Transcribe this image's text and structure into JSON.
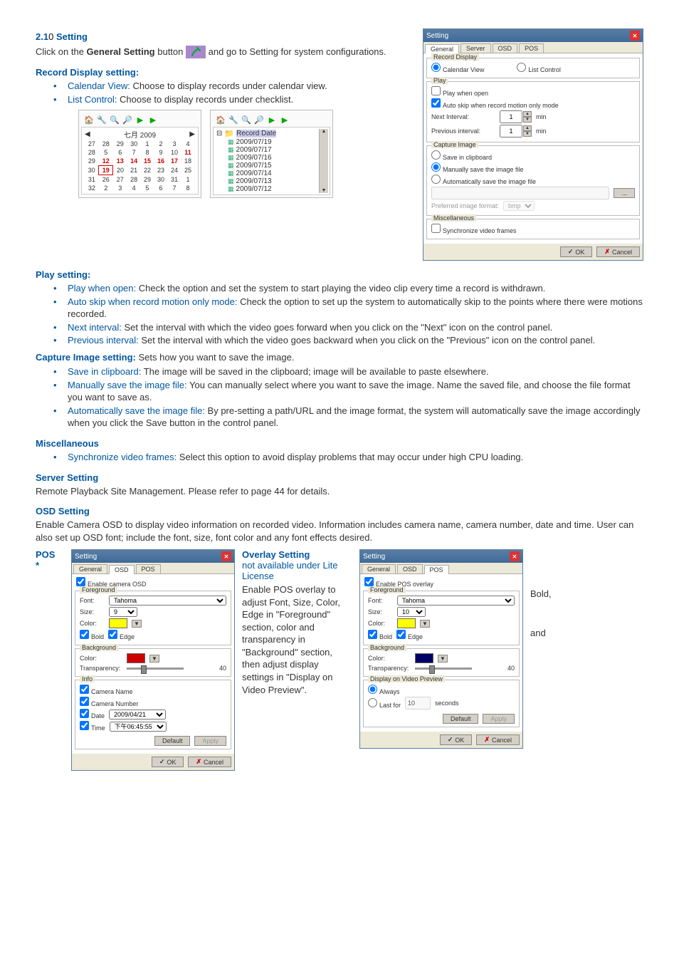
{
  "sections": {
    "title_num": "2.1",
    "title_num_suffix": "0",
    "title_text": "Setting",
    "intro1a": "Click on the ",
    "intro1b": "General Setting",
    "intro1c": " button ",
    "intro1d": " and go to Setting for system configurations.",
    "record_display_heading": "Record Display setting:",
    "record_display": [
      {
        "label": "Calendar View:",
        "text": " Choose to display records under calendar view."
      },
      {
        "label": "List Control:",
        "text": " Choose to display records under checklist."
      }
    ],
    "calendar_month": "七月 2009",
    "list_root": "Record Date",
    "list_items": [
      "2009/07/19",
      "2009/07/17",
      "2009/07/16",
      "2009/07/15",
      "2009/07/14",
      "2009/07/13",
      "2009/07/12"
    ],
    "play_heading": "Play setting:",
    "play": [
      {
        "label": "Play when open:",
        "text": " Check the option and set the system to start playing the video clip every time a record is withdrawn."
      },
      {
        "label": "Auto skip when record motion only mode:",
        "text": " Check the option to set up the system to automatically skip to the points where there were motions recorded."
      },
      {
        "label": "Next interval:",
        "text": " Set the interval with which the video goes forward when you click on the \"Next\" icon on the control panel."
      },
      {
        "label": "Previous interval:",
        "text": " Set the interval with which the video goes backward when you click on the \"Previous\" icon on the control panel."
      }
    ],
    "capture_heading_a": "Capture Image setting:",
    "capture_heading_b": " Sets how you want to save the image.",
    "capture": [
      {
        "label": "Save in clipboard:",
        "text": " The image will be saved in the clipboard; image will be available to paste elsewhere."
      },
      {
        "label": "Manually save the image file:",
        "text": " You can manually select where you want to save the image. Name the saved file, and choose the file format you want to save as."
      },
      {
        "label": "Automatically save the image file:",
        "text": " By pre-setting a path/URL and the image format, the system will automatically save the image accordingly when you click the Save button in the control panel."
      }
    ],
    "misc_heading": "Miscellaneous",
    "misc": [
      {
        "label": "Synchronize video frames:",
        "text": " Select this option to avoid display problems that may occur under high CPU loading."
      }
    ],
    "server_heading": "Server Setting",
    "server_text": "Remote Playback Site Management.    Please refer to page 44 for details.",
    "osd_heading": "OSD Setting",
    "osd_text": "Enable Camera OSD to display video information on recorded video.    Information includes camera name, camera number, date and time. User can also set up OSD font; include the font, size, font color and any font effects desired.",
    "pos_label": "POS",
    "pos_star": "*",
    "overlay_heading": "Overlay Setting",
    "overlay_sub": "not available under Lite License",
    "overlay_text": "Enable POS overlay to adjust Font, Size, Color, Edge in \"Foreground\" section, color and transparency in \"Background\" section, then adjust display settings in \"Display on Video Preview\".",
    "overlay_right1": "Bold,",
    "overlay_right2": "and"
  },
  "dialog1": {
    "title": "Setting",
    "tabs": [
      "General",
      "Server",
      "OSD",
      "POS"
    ],
    "groups": {
      "record_display": {
        "title": "Record Display",
        "calendar": "Calendar View",
        "list": "List Control"
      },
      "play": {
        "title": "Play",
        "open": "Play when open",
        "autoskip": "Auto skip when record motion only mode",
        "next": "Next Interval:",
        "prev": "Previous interval:",
        "min": "min",
        "val1": "1",
        "val2": "1"
      },
      "capture": {
        "title": "Capture Image",
        "clip": "Save in clipboard",
        "manual": "Manually save the image file",
        "auto": "Automatically save the image file",
        "pref": "Preferred image format:",
        "fmt": "bmp",
        "browse": "..."
      },
      "misc": {
        "title": "Miscellaneous",
        "sync": "Synchronize video frames"
      }
    },
    "ok": "OK",
    "cancel": "Cancel"
  },
  "dialog2": {
    "title": "Setting",
    "tabs": [
      "General",
      "OSD",
      "POS"
    ],
    "enable": "Enable camera OSD",
    "fore": {
      "title": "Foreground",
      "font_l": "Font:",
      "font_v": "Tahoma",
      "size_l": "Size:",
      "size_v": "9",
      "color_l": "Color:",
      "bold": "Bold",
      "edge": "Edge"
    },
    "back": {
      "title": "Background",
      "color_l": "Color:",
      "trans_l": "Transparency:",
      "trans_v": "40"
    },
    "info": {
      "title": "Info",
      "cam_name": "Camera Name",
      "cam_num": "Camera Number",
      "date_l": "Date",
      "date_v": "2009/04/21",
      "time_l": "Time",
      "time_v": "下午06:45:55"
    },
    "default": "Default",
    "apply": "Apply",
    "ok": "OK",
    "cancel": "Cancel"
  },
  "dialog3": {
    "title": "Setting",
    "tabs": [
      "General",
      "OSD",
      "POS"
    ],
    "enable": "Enable POS overlay",
    "fore": {
      "title": "Foreground",
      "font_l": "Font:",
      "font_v": "Tahoma",
      "size_l": "Size:",
      "size_v": "10",
      "color_l": "Color:",
      "bold": "Bold",
      "edge": "Edge"
    },
    "back": {
      "title": "Background",
      "color_l": "Color:",
      "trans_l": "Transparency:",
      "trans_v": "40"
    },
    "disp": {
      "title": "Display on Video Preview",
      "always": "Always",
      "last": "Last for",
      "last_v": "10",
      "seconds": "seconds"
    },
    "default": "Default",
    "apply": "Apply",
    "ok": "OK",
    "cancel": "Cancel"
  }
}
